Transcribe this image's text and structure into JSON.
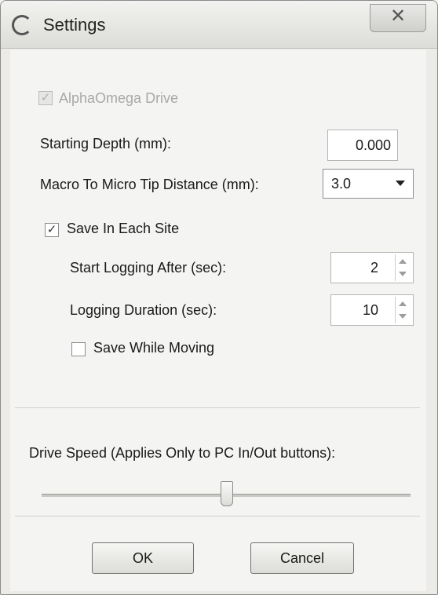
{
  "window": {
    "title": "Settings",
    "close_symbol": "✕"
  },
  "drive": {
    "label": "AlphaOmega Drive",
    "checked": true,
    "enabled": false
  },
  "starting_depth": {
    "label": "Starting Depth (mm):",
    "value": "0.000"
  },
  "tip_distance": {
    "label": "Macro To Micro Tip Distance (mm):",
    "value": "3.0"
  },
  "save_each_site": {
    "label": "Save In Each Site",
    "checked": true
  },
  "start_logging": {
    "label": "Start Logging After (sec):",
    "value": "2"
  },
  "logging_duration": {
    "label": "Logging Duration (sec):",
    "value": "10"
  },
  "save_while_moving": {
    "label": "Save While Moving",
    "checked": false
  },
  "drive_speed": {
    "label": "Drive Speed (Applies Only to PC In/Out buttons):",
    "level": 0.5
  },
  "buttons": {
    "ok": "OK",
    "cancel": "Cancel"
  },
  "check_glyph": "✓"
}
